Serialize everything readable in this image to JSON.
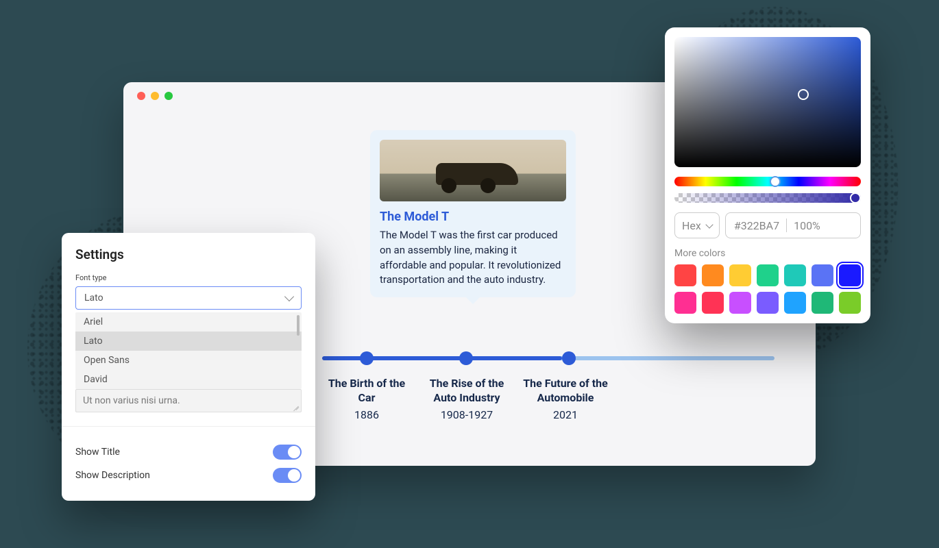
{
  "settings": {
    "title": "Settings",
    "font_type_label": "Font type",
    "font_selected": "Lato",
    "font_options": [
      "Ariel",
      "Lato",
      "Open Sans",
      "David"
    ],
    "textarea_value": "Ut non varius nisi urna.",
    "show_title_label": "Show Title",
    "show_description_label": "Show Description"
  },
  "card": {
    "title": "The Model T",
    "description": "The Model T was the first car produced on an assembly line, making it affordable and popular. It revolutionized transportation and the auto industry."
  },
  "timeline": [
    {
      "title": "The Birth of the Car",
      "year": "1886"
    },
    {
      "title": "The Rise of the Auto Industry",
      "year": "1908-1927"
    },
    {
      "title": "The Future of the Automobile",
      "year": "2021"
    }
  ],
  "color_picker": {
    "format": "Hex",
    "hex": "#322BA7",
    "opacity": "100%",
    "more_colors_label": "More colors",
    "swatches": [
      "#ff4444",
      "#ff8a1f",
      "#ffcc33",
      "#1fd18b",
      "#1fc9b8",
      "#5a73f5",
      "#1a1aff",
      "#ff2f92",
      "#ff3355",
      "#c84fff",
      "#7a5cff",
      "#1fa3ff",
      "#1fb877",
      "#7acc29"
    ],
    "selected_swatch_index": 6
  }
}
